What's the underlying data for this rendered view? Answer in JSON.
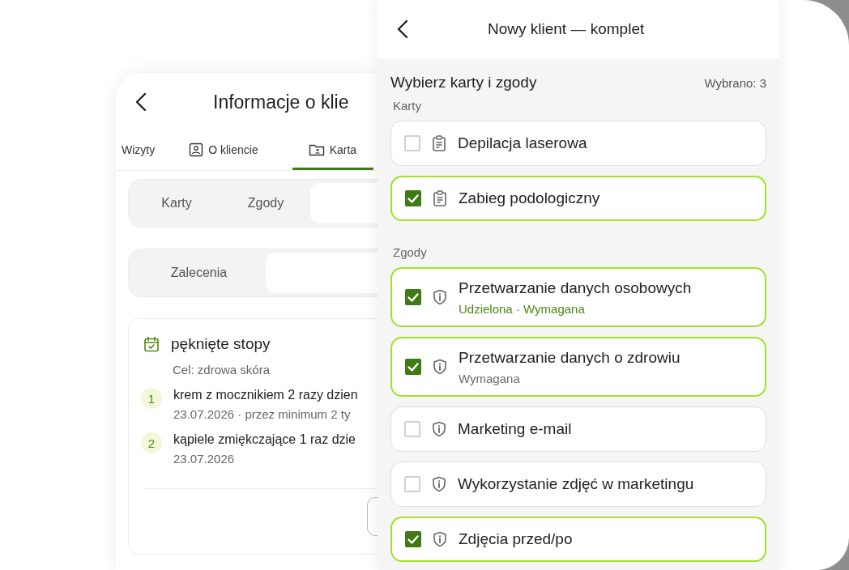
{
  "back_screen": {
    "title": "Informacje o klie",
    "tabs": [
      {
        "label": "Wizyty",
        "kind": "plain",
        "selected": false
      },
      {
        "label": "O kliencie",
        "kind": "person",
        "selected": false
      },
      {
        "label": "Karta",
        "kind": "folder",
        "selected": true
      }
    ],
    "segments": [
      {
        "label": "Karty",
        "selected": false
      },
      {
        "label": "Zgody",
        "selected": false
      },
      {
        "selected": true
      }
    ],
    "subsegments": [
      {
        "label": "Zalecenia",
        "selected": false
      },
      {
        "selected": true
      }
    ],
    "plan": {
      "title": "pęknięte stopy",
      "goal": "Cel: zdrowa skóra",
      "steps": [
        {
          "number": "1",
          "text": "krem z mocznikiem 2 razy dzien",
          "meta": "23.07.2026 · przez minimum 2 ty"
        },
        {
          "number": "2",
          "text": "kąpiele zmiękczające 1 raz dzie",
          "meta": "23.07.2026"
        }
      ]
    }
  },
  "front_screen": {
    "title": "Nowy klient — komplet",
    "heading": "Wybierz karty i zgody",
    "count": "Wybrano: 3",
    "sections": [
      {
        "label": "Karty",
        "items": [
          {
            "kind": "card",
            "label": "Depilacja laserowa",
            "checked": false
          },
          {
            "kind": "card",
            "label": "Zabieg podologiczny",
            "checked": true
          }
        ]
      },
      {
        "label": "Zgody",
        "items": [
          {
            "kind": "consent",
            "label": "Przetwarzanie danych osobowych",
            "subtitle": "Udzielona · Wymagana",
            "color": "#4d8a12",
            "checked": true
          },
          {
            "kind": "consent",
            "label": "Przetwarzanie danych o zdrowiu",
            "subtitle": "Wymagana",
            "color": "#6b6b6b",
            "checked": true
          },
          {
            "kind": "consent",
            "label": "Marketing e-mail",
            "checked": false
          },
          {
            "kind": "consent",
            "label": "Wykorzystanie zdjęć w marketingu",
            "checked": false
          },
          {
            "kind": "consent",
            "label": "Zdjęcia przed/po",
            "checked": true
          }
        ]
      }
    ]
  }
}
